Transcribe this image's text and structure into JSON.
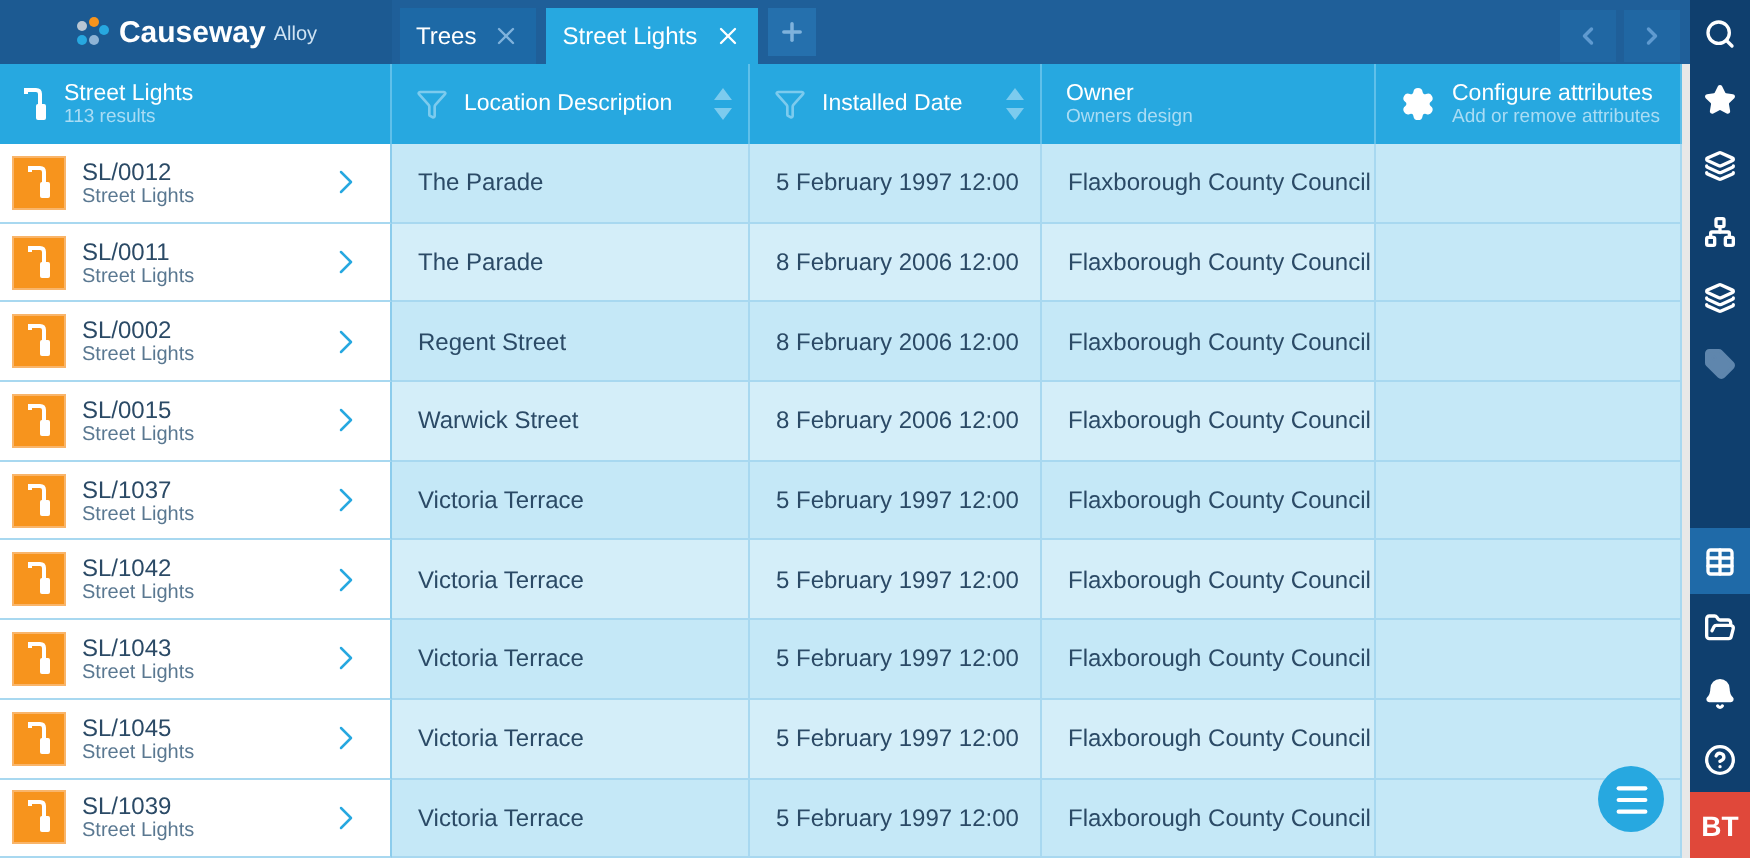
{
  "app": {
    "brand": "Causeway",
    "product": "Alloy"
  },
  "tabs": [
    {
      "label": "Trees",
      "selected": false
    },
    {
      "label": "Street Lights",
      "selected": true
    }
  ],
  "list_header": {
    "title": "Street Lights",
    "subtitle": "113 results"
  },
  "columns": [
    {
      "kind": "filter",
      "label": "Location Description"
    },
    {
      "kind": "filter",
      "label": "Installed Date"
    },
    {
      "kind": "plain",
      "label": "Owner",
      "subtitle": "Owners design"
    },
    {
      "kind": "configure",
      "label": "Configure attributes",
      "subtitle": "Add or remove attributes"
    }
  ],
  "rows": [
    {
      "id": "SL/0012",
      "type": "Street Lights",
      "cells": [
        "The Parade",
        "5 February 1997 12:00",
        "Flaxborough County Council"
      ]
    },
    {
      "id": "SL/0011",
      "type": "Street Lights",
      "cells": [
        "The Parade",
        "8 February 2006 12:00",
        "Flaxborough County Council"
      ]
    },
    {
      "id": "SL/0002",
      "type": "Street Lights",
      "cells": [
        "Regent Street",
        "8 February 2006 12:00",
        "Flaxborough County Council"
      ]
    },
    {
      "id": "SL/0015",
      "type": "Street Lights",
      "cells": [
        "Warwick Street",
        "8 February 2006 12:00",
        "Flaxborough County Council"
      ]
    },
    {
      "id": "SL/1037",
      "type": "Street Lights",
      "cells": [
        "Victoria Terrace",
        "5 February 1997 12:00",
        "Flaxborough County Council"
      ]
    },
    {
      "id": "SL/1042",
      "type": "Street Lights",
      "cells": [
        "Victoria Terrace",
        "5 February 1997 12:00",
        "Flaxborough County Council"
      ]
    },
    {
      "id": "SL/1043",
      "type": "Street Lights",
      "cells": [
        "Victoria Terrace",
        "5 February 1997 12:00",
        "Flaxborough County Council"
      ]
    },
    {
      "id": "SL/1045",
      "type": "Street Lights",
      "cells": [
        "Victoria Terrace",
        "5 February 1997 12:00",
        "Flaxborough County Council"
      ]
    },
    {
      "id": "SL/1039",
      "type": "Street Lights",
      "cells": [
        "Victoria Terrace",
        "5 February 1997 12:00",
        "Flaxborough County Council"
      ]
    }
  ],
  "sidebar": {
    "top": [
      {
        "kind": "search",
        "selected": false,
        "disabled": false
      },
      {
        "kind": "star",
        "selected": false,
        "disabled": false
      },
      {
        "kind": "layers",
        "selected": false,
        "disabled": false
      },
      {
        "kind": "network",
        "selected": false,
        "disabled": false
      },
      {
        "kind": "layers",
        "selected": false,
        "disabled": false
      },
      {
        "kind": "tag",
        "selected": false,
        "disabled": true
      }
    ],
    "bottom": [
      {
        "kind": "table",
        "selected": true,
        "disabled": false
      },
      {
        "kind": "folder",
        "selected": false,
        "disabled": false
      },
      {
        "kind": "bell",
        "selected": false,
        "disabled": false
      },
      {
        "kind": "help",
        "selected": false,
        "disabled": false
      }
    ]
  },
  "user": {
    "initials": "BT"
  }
}
